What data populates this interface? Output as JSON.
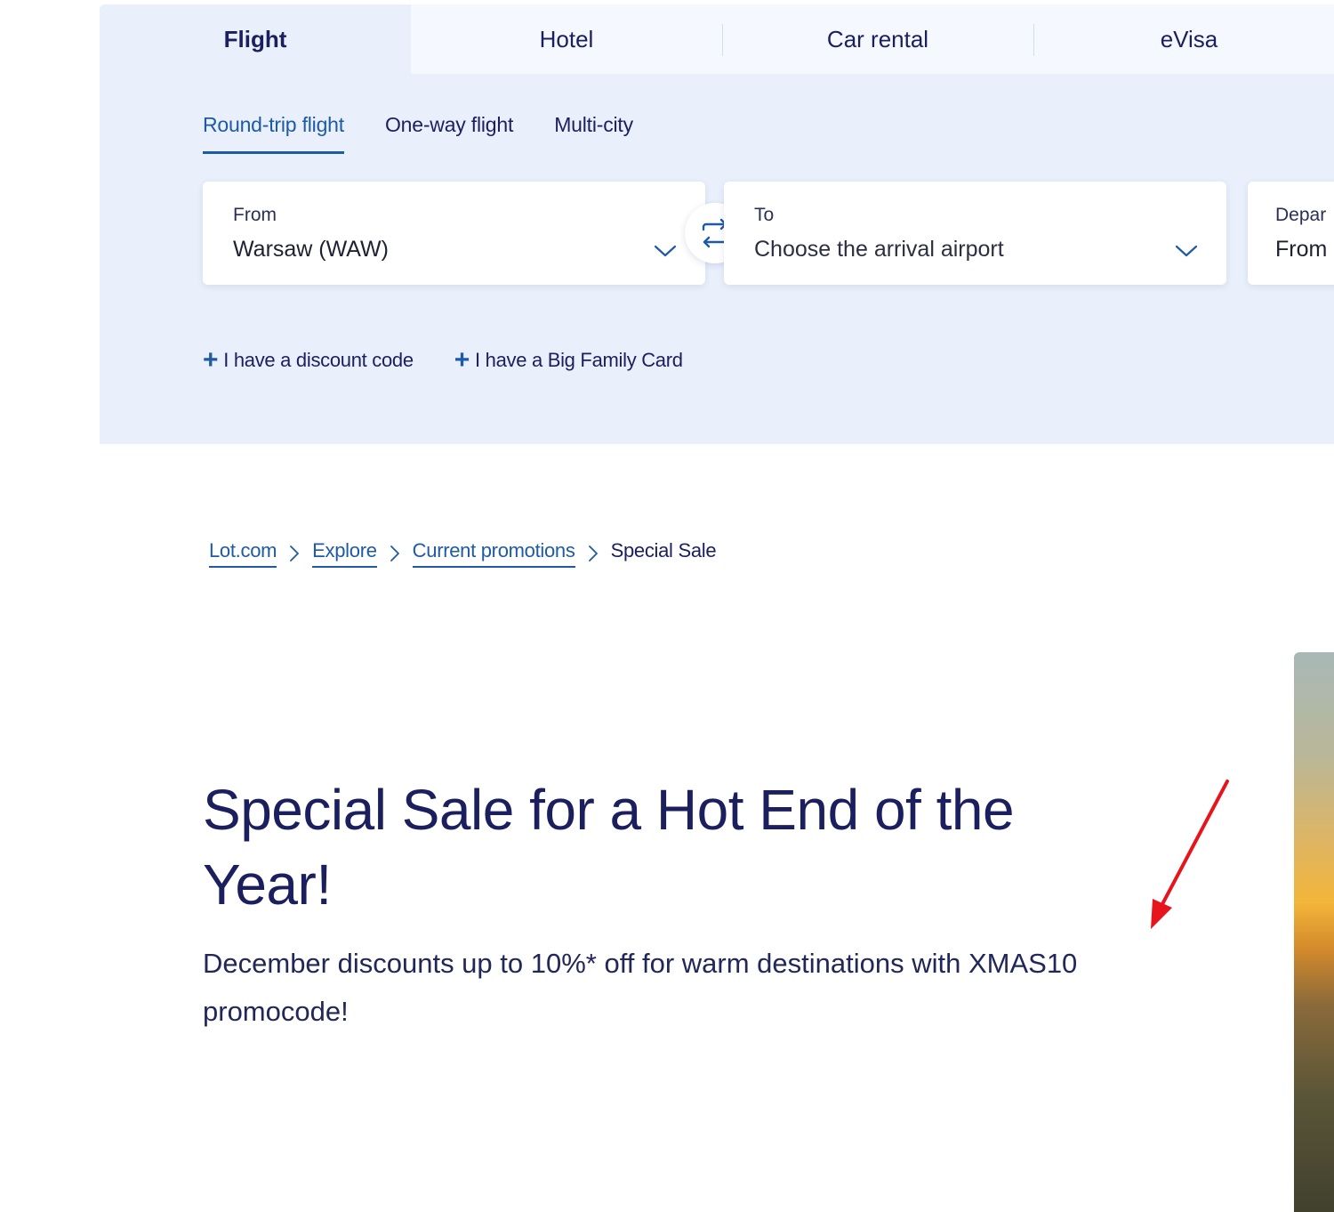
{
  "booking": {
    "tabs": [
      {
        "label": "Flight"
      },
      {
        "label": "Hotel"
      },
      {
        "label": "Car rental"
      },
      {
        "label": "eVisa"
      }
    ],
    "trip_types": [
      {
        "label": "Round-trip flight"
      },
      {
        "label": "One-way flight"
      },
      {
        "label": "Multi-city"
      }
    ],
    "from": {
      "label": "From",
      "value": "Warsaw (WAW)"
    },
    "to": {
      "label": "To",
      "value": "Choose the arrival airport"
    },
    "departure": {
      "label": "Depar",
      "value": "From"
    },
    "extras": [
      {
        "label": "I have a discount code"
      },
      {
        "label": "I have a Big Family Card"
      }
    ]
  },
  "breadcrumb": {
    "items": [
      {
        "label": "Lot.com"
      },
      {
        "label": "Explore"
      },
      {
        "label": "Current promotions"
      }
    ],
    "current": "Special Sale"
  },
  "hero": {
    "title": "Special Sale for a Hot End of the Year!",
    "subtitle": "December discounts up to 10%* off for warm destinations with XMAS10 promocode!"
  },
  "colors": {
    "primary_text": "#1b1f5e",
    "link": "#1e5aa6",
    "panel_bg": "#e9f0fc",
    "annotation_arrow": "#e8141c"
  }
}
